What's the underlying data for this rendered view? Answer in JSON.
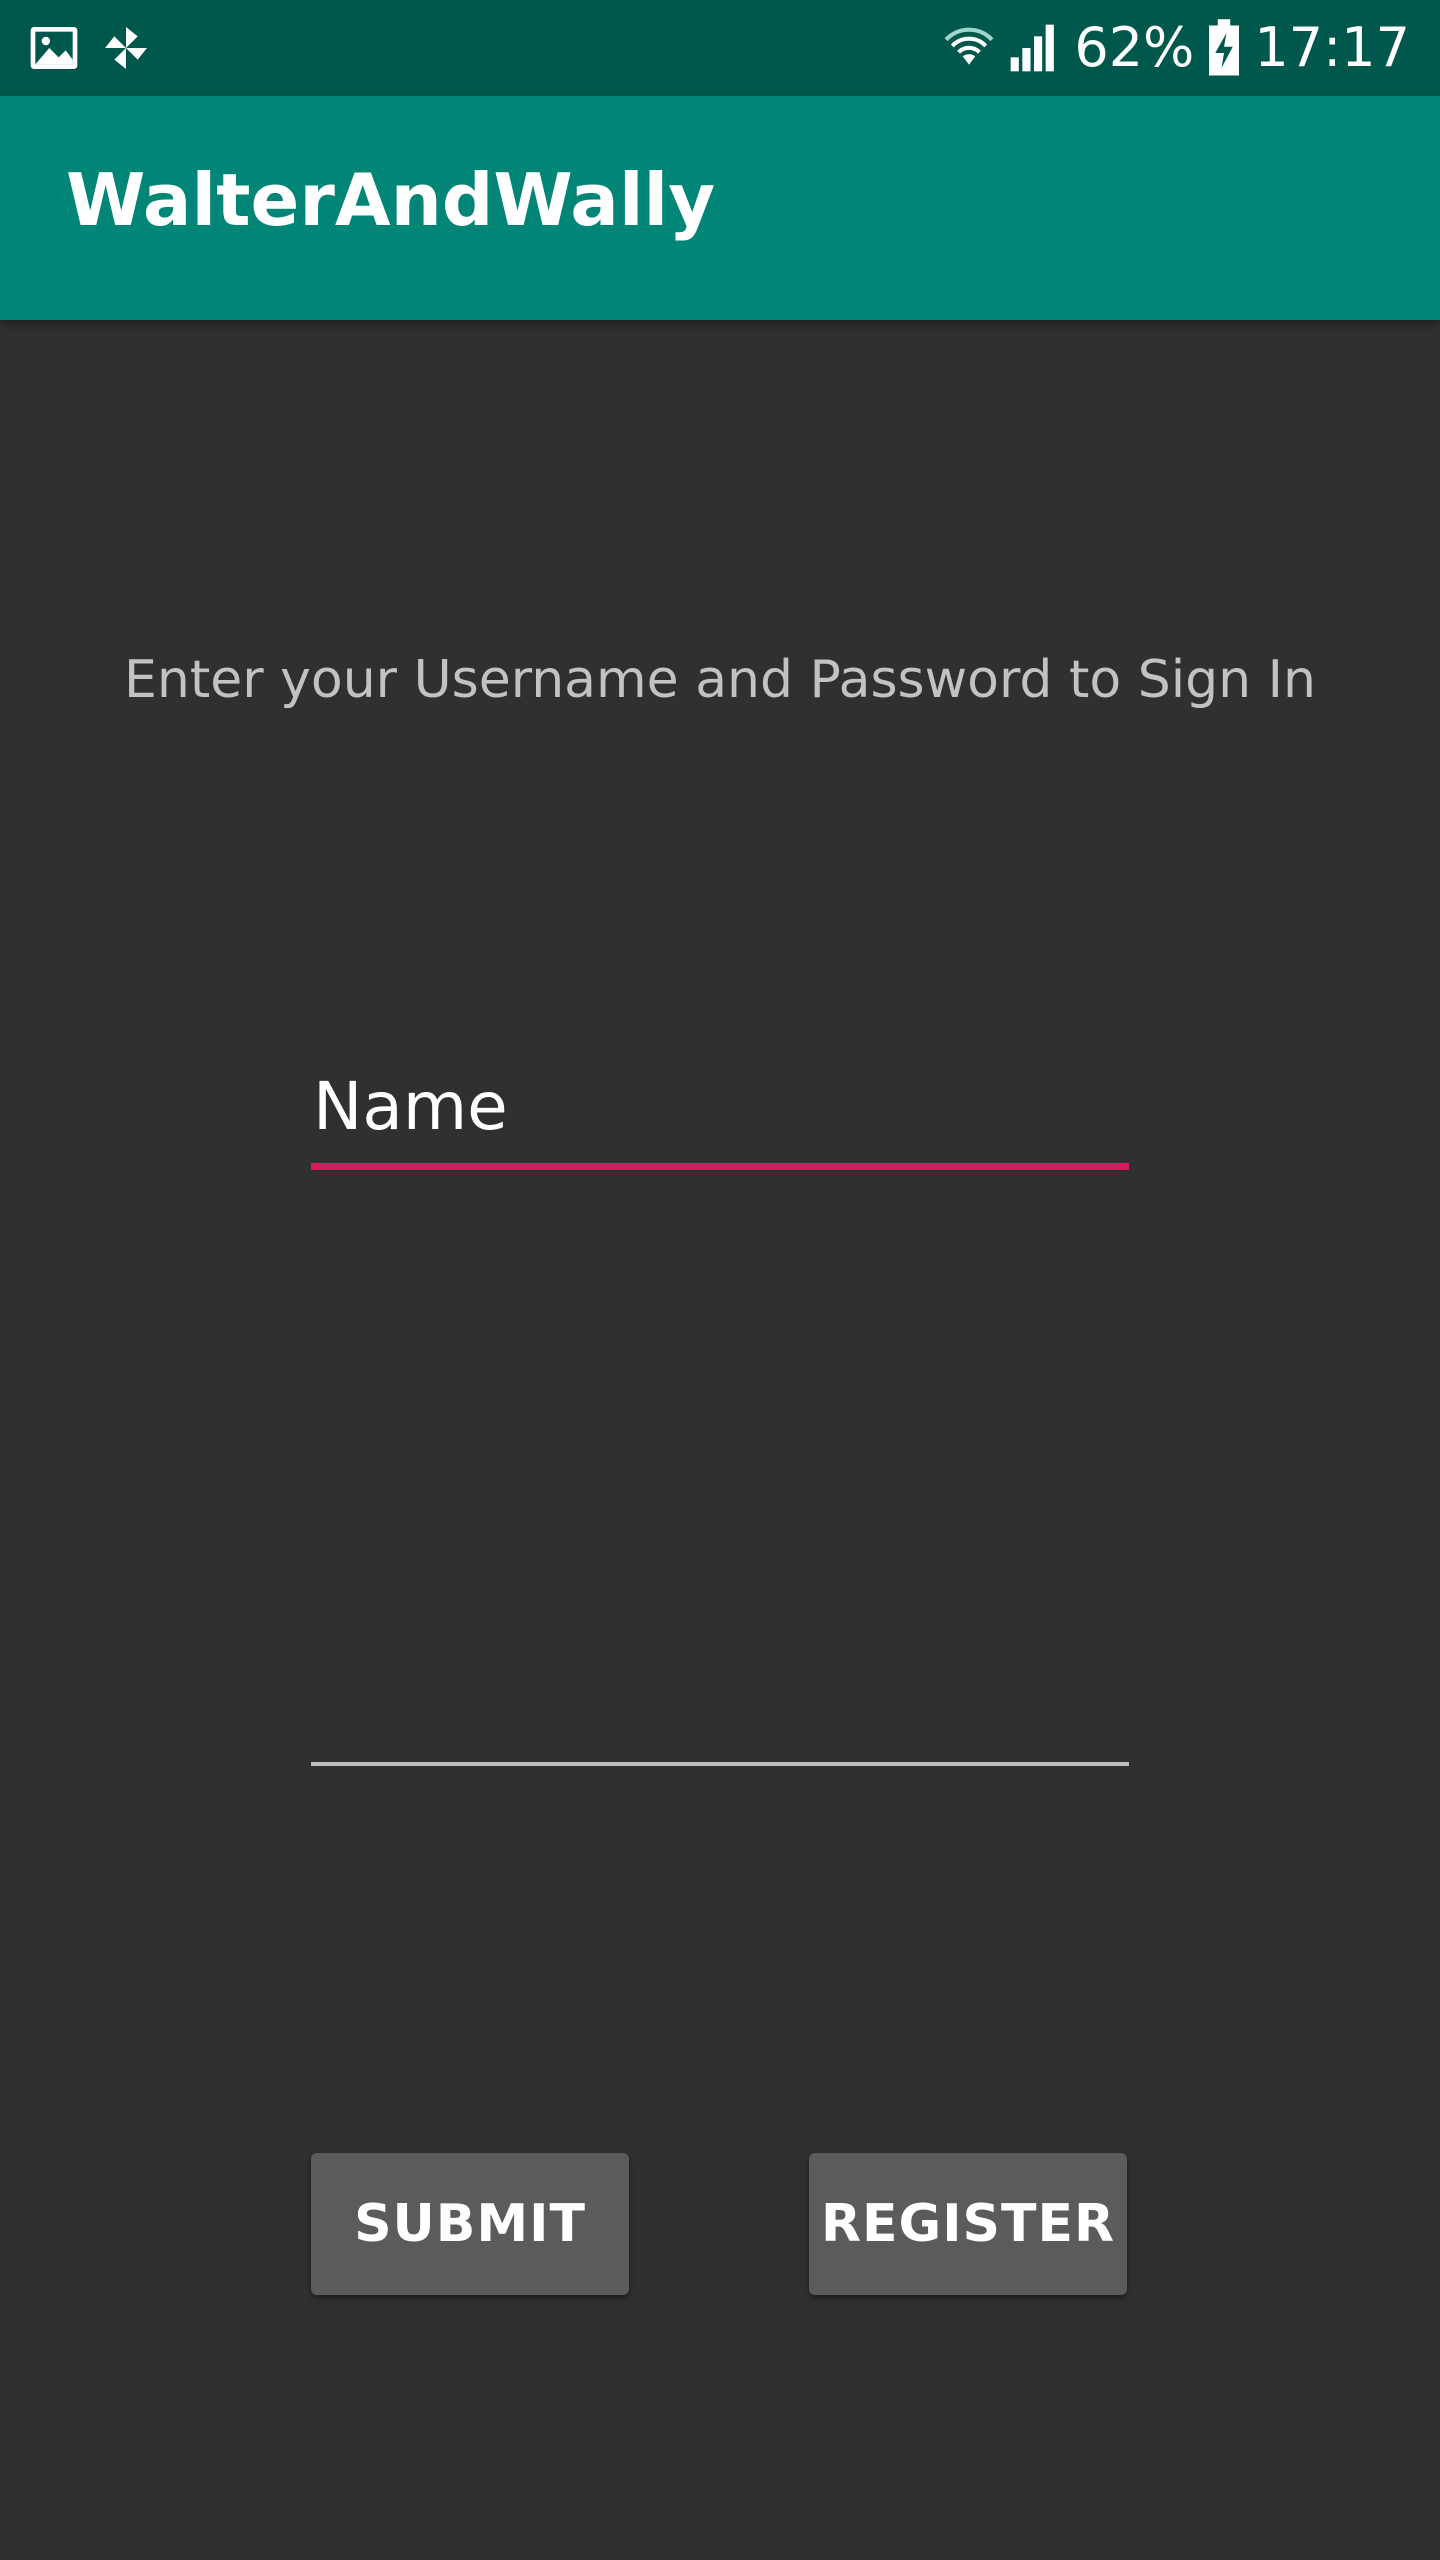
{
  "status_bar": {
    "icons_left": [
      "image-icon",
      "pinwheel-icon"
    ],
    "icons_right": [
      "wifi-icon",
      "signal-icon",
      "battery-charging-icon"
    ],
    "battery": "62%",
    "time": "17:17",
    "color": "#00574b"
  },
  "app_bar": {
    "title": "WalterAndWally",
    "color": "#008577"
  },
  "login": {
    "instruction": "Enter your Username and Password to Sign In",
    "name_field": {
      "value": "Name",
      "accent_color": "#d81b60"
    },
    "password_field": {
      "value": ""
    },
    "submit_label": "SUBMIT",
    "register_label": "REGISTER"
  }
}
